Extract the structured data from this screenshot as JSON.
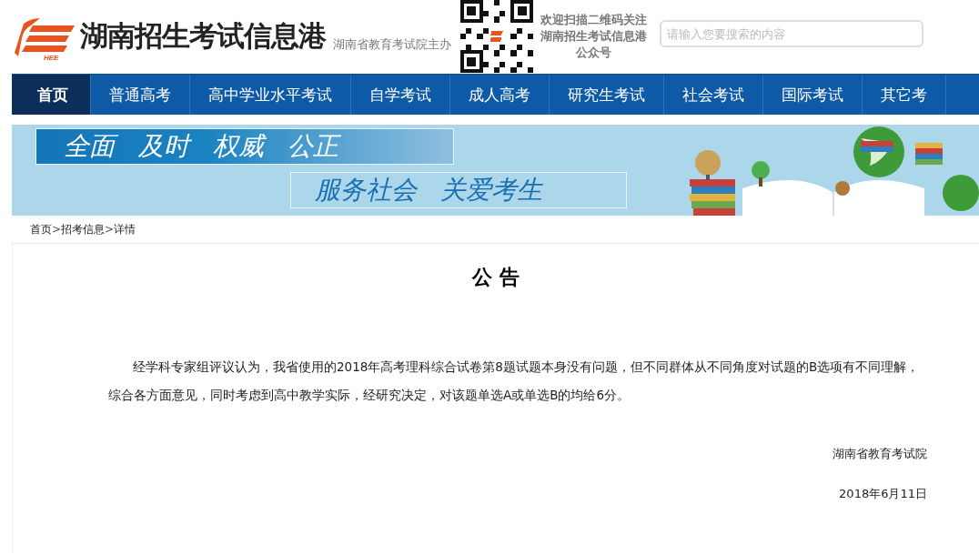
{
  "header": {
    "site_title": "湖南招生考试信息港",
    "host": "湖南省教育考试院主办",
    "logo_caption": "HEE",
    "qr_caption": [
      "欢迎扫描二维码关注",
      "湖南招生考试信息港",
      "公众号"
    ],
    "search": {
      "placeholder": "请输入您要搜索的内容"
    }
  },
  "nav": [
    {
      "label": "首页",
      "selected": true
    },
    {
      "label": "普通高考",
      "selected": false
    },
    {
      "label": "高中学业水平考试",
      "selected": false
    },
    {
      "label": "自学考试",
      "selected": false
    },
    {
      "label": "成人高考",
      "selected": false
    },
    {
      "label": "研究生考试",
      "selected": false
    },
    {
      "label": "社会考试",
      "selected": false
    },
    {
      "label": "国际考试",
      "selected": false
    },
    {
      "label": "其它考",
      "selected": false
    }
  ],
  "banner": {
    "slogans": [
      {
        "kind": "top",
        "parts": [
          "全面",
          "及时",
          "权威",
          "公正"
        ]
      },
      {
        "kind": "bottom",
        "parts": [
          "服务社会",
          "关爱考生"
        ]
      }
    ]
  },
  "breadcrumb": [
    "首页",
    "招考信息",
    "详情"
  ],
  "breadcrumb_separator": ">",
  "article": {
    "title": "公 告",
    "body": "经学科专家组评议认为，我省使用的2018年高考理科综合试卷第8题试题本身没有问题，但不同群体从不同角度对试题的B选项有不同理解，综合各方面意见，同时考虑到高中教学实际，经研究决定，对该题单选A或单选B的均给6分。",
    "signature": "湖南省教育考试院",
    "date": "2018年6月11日"
  }
}
